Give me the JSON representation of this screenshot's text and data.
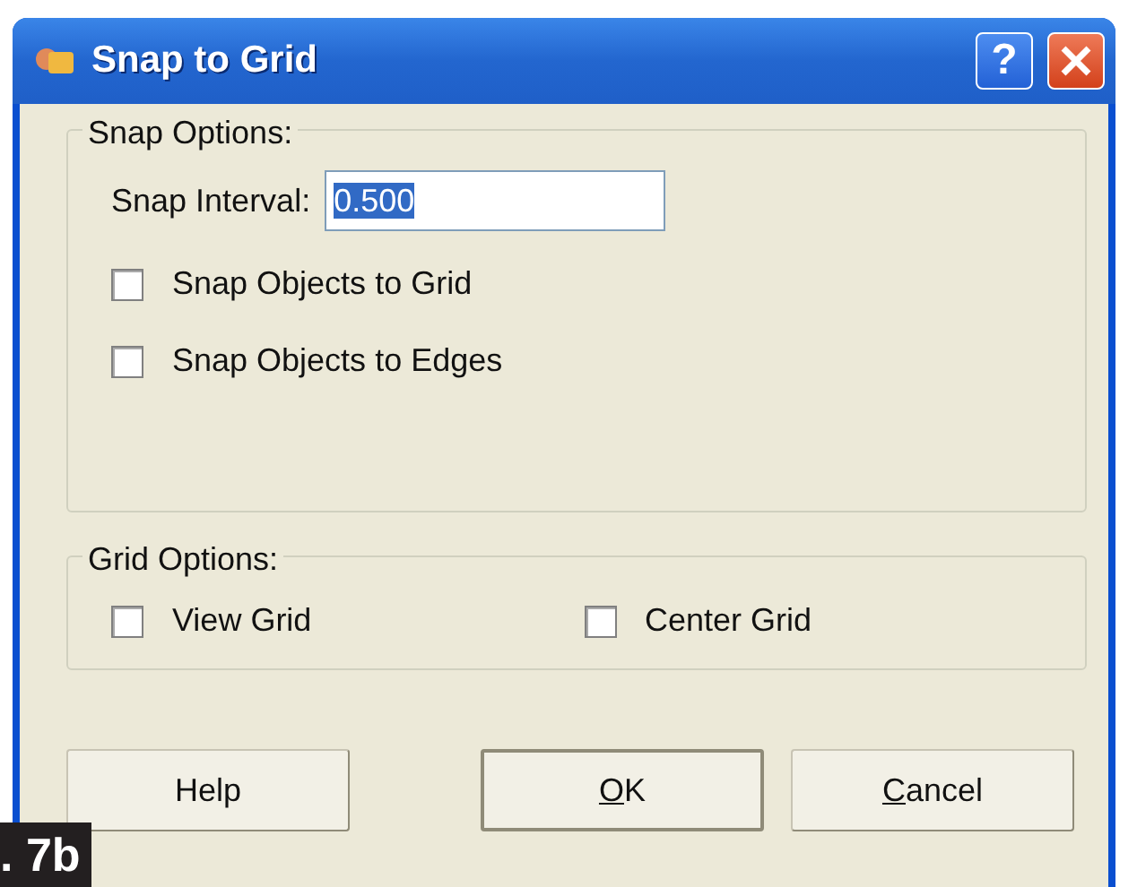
{
  "window": {
    "title": "Snap to Grid",
    "help_glyph": "?"
  },
  "snap_options": {
    "legend": "Snap Options:",
    "interval_label": "Snap Interval:",
    "interval_value": "0.500",
    "value_selected": true,
    "checkboxes": [
      {
        "label": "Snap Objects to Grid",
        "checked": false
      },
      {
        "label": "Snap Objects to Edges",
        "checked": false
      }
    ]
  },
  "grid_options": {
    "legend": "Grid Options:",
    "checkboxes": [
      {
        "label": "View Grid",
        "checked": false
      },
      {
        "label": "Center Grid",
        "checked": false
      }
    ]
  },
  "buttons": [
    {
      "label": "Help",
      "mnemonic": false,
      "default": false
    },
    {
      "label": "OK",
      "mnemonic": true,
      "default": true
    },
    {
      "label": "Cancel",
      "mnemonic": true,
      "default": false
    }
  ],
  "figure_label": ". 7b"
}
